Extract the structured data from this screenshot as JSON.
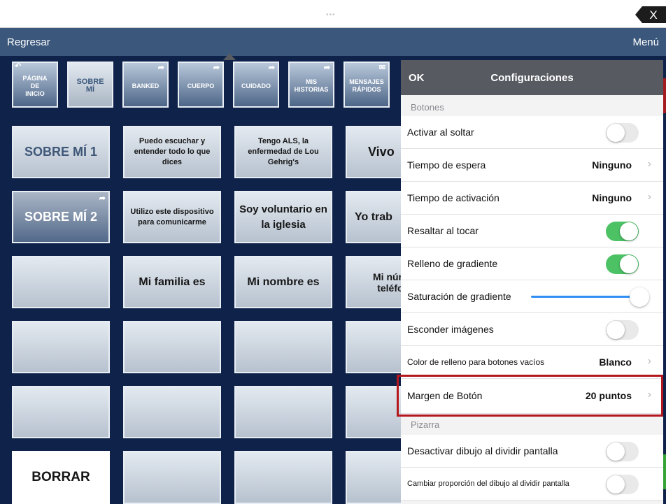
{
  "topbar": {
    "dots": "•••",
    "close_label": "X"
  },
  "navbar": {
    "back": "Regresar",
    "menu": "Menú"
  },
  "nav_buttons": [
    {
      "l1": "PÁGINA",
      "l2": "DE",
      "l3": "INICIO"
    },
    {
      "l1": "SOBRE",
      "l2": "MÍ"
    },
    {
      "l1": "BANKED"
    },
    {
      "l1": "CUERPO"
    },
    {
      "l1": "CUIDADO"
    },
    {
      "l1": "MIS",
      "l2": "HISTORIAS"
    },
    {
      "l1": "MENSAJES",
      "l2": "RÁPIDOS"
    }
  ],
  "grid": {
    "sobre_mi_1": "SOBRE MÍ 1",
    "puedo": "Puedo escuchar y entender todo lo que dices",
    "tengo_als": "Tengo ALS, la enfermedad de Lou Gehrig's",
    "vivo": "Vivo",
    "sobre_mi_2": "SOBRE MÍ 2",
    "utilizo": "Utilizo este dispositivo para comunicarme",
    "voluntario": "Soy voluntario en la iglesia",
    "yo_trab": "Yo trab",
    "familia": "Mi familia es",
    "nombre": "Mi nombre es",
    "numero_l1": "Mi núm",
    "numero_l2": "teléfor",
    "borrar": "BORRAR"
  },
  "panel": {
    "ok": "OK",
    "title": "Configuraciones",
    "section_botones": "Botones",
    "section_pizarra": "Pizarra",
    "rows": {
      "activar": {
        "label": "Activar al soltar",
        "on": false
      },
      "espera": {
        "label": "Tiempo de espera",
        "value": "Ninguno"
      },
      "activacion": {
        "label": "Tiempo de activación",
        "value": "Ninguno"
      },
      "resaltar": {
        "label": "Resaltar al tocar",
        "on": true
      },
      "relleno": {
        "label": "Relleno de gradiente",
        "on": true
      },
      "saturacion": {
        "label": "Saturación de gradiente",
        "level": 1.0
      },
      "esconder": {
        "label": "Esconder imágenes",
        "on": false
      },
      "color": {
        "label": "Color de relleno para botones vacíos",
        "value": "Blanco"
      },
      "margen": {
        "label": "Margen de Botón",
        "value": "20 puntos"
      },
      "desactivar": {
        "label": "Desactivar dibujo al dividir pantalla",
        "on": false
      },
      "cambiar": {
        "label": "Cambiar proporción del dibujo al dividir pantalla",
        "on": false
      }
    }
  },
  "colors": {
    "background": "#0f2249",
    "navbar": "#3b577c",
    "panel_header": "#575b61",
    "toggle_on": "#4cc265",
    "slider": "#2f8ef3",
    "highlight": "#b4161e"
  }
}
